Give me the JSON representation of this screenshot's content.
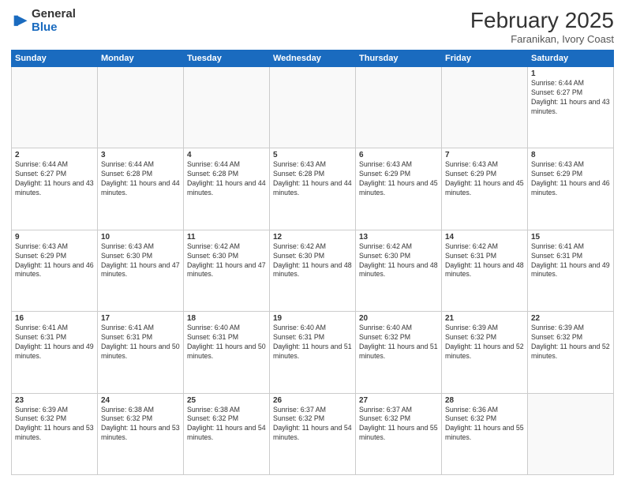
{
  "logo": {
    "general": "General",
    "blue": "Blue"
  },
  "title": "February 2025",
  "location": "Faranikan, Ivory Coast",
  "days_of_week": [
    "Sunday",
    "Monday",
    "Tuesday",
    "Wednesday",
    "Thursday",
    "Friday",
    "Saturday"
  ],
  "weeks": [
    [
      {
        "day": "",
        "info": ""
      },
      {
        "day": "",
        "info": ""
      },
      {
        "day": "",
        "info": ""
      },
      {
        "day": "",
        "info": ""
      },
      {
        "day": "",
        "info": ""
      },
      {
        "day": "",
        "info": ""
      },
      {
        "day": "1",
        "info": "Sunrise: 6:44 AM\nSunset: 6:27 PM\nDaylight: 11 hours and 43 minutes."
      }
    ],
    [
      {
        "day": "2",
        "info": "Sunrise: 6:44 AM\nSunset: 6:27 PM\nDaylight: 11 hours and 43 minutes."
      },
      {
        "day": "3",
        "info": "Sunrise: 6:44 AM\nSunset: 6:28 PM\nDaylight: 11 hours and 44 minutes."
      },
      {
        "day": "4",
        "info": "Sunrise: 6:44 AM\nSunset: 6:28 PM\nDaylight: 11 hours and 44 minutes."
      },
      {
        "day": "5",
        "info": "Sunrise: 6:43 AM\nSunset: 6:28 PM\nDaylight: 11 hours and 44 minutes."
      },
      {
        "day": "6",
        "info": "Sunrise: 6:43 AM\nSunset: 6:29 PM\nDaylight: 11 hours and 45 minutes."
      },
      {
        "day": "7",
        "info": "Sunrise: 6:43 AM\nSunset: 6:29 PM\nDaylight: 11 hours and 45 minutes."
      },
      {
        "day": "8",
        "info": "Sunrise: 6:43 AM\nSunset: 6:29 PM\nDaylight: 11 hours and 46 minutes."
      }
    ],
    [
      {
        "day": "9",
        "info": "Sunrise: 6:43 AM\nSunset: 6:29 PM\nDaylight: 11 hours and 46 minutes."
      },
      {
        "day": "10",
        "info": "Sunrise: 6:43 AM\nSunset: 6:30 PM\nDaylight: 11 hours and 47 minutes."
      },
      {
        "day": "11",
        "info": "Sunrise: 6:42 AM\nSunset: 6:30 PM\nDaylight: 11 hours and 47 minutes."
      },
      {
        "day": "12",
        "info": "Sunrise: 6:42 AM\nSunset: 6:30 PM\nDaylight: 11 hours and 48 minutes."
      },
      {
        "day": "13",
        "info": "Sunrise: 6:42 AM\nSunset: 6:30 PM\nDaylight: 11 hours and 48 minutes."
      },
      {
        "day": "14",
        "info": "Sunrise: 6:42 AM\nSunset: 6:31 PM\nDaylight: 11 hours and 48 minutes."
      },
      {
        "day": "15",
        "info": "Sunrise: 6:41 AM\nSunset: 6:31 PM\nDaylight: 11 hours and 49 minutes."
      }
    ],
    [
      {
        "day": "16",
        "info": "Sunrise: 6:41 AM\nSunset: 6:31 PM\nDaylight: 11 hours and 49 minutes."
      },
      {
        "day": "17",
        "info": "Sunrise: 6:41 AM\nSunset: 6:31 PM\nDaylight: 11 hours and 50 minutes."
      },
      {
        "day": "18",
        "info": "Sunrise: 6:40 AM\nSunset: 6:31 PM\nDaylight: 11 hours and 50 minutes."
      },
      {
        "day": "19",
        "info": "Sunrise: 6:40 AM\nSunset: 6:31 PM\nDaylight: 11 hours and 51 minutes."
      },
      {
        "day": "20",
        "info": "Sunrise: 6:40 AM\nSunset: 6:32 PM\nDaylight: 11 hours and 51 minutes."
      },
      {
        "day": "21",
        "info": "Sunrise: 6:39 AM\nSunset: 6:32 PM\nDaylight: 11 hours and 52 minutes."
      },
      {
        "day": "22",
        "info": "Sunrise: 6:39 AM\nSunset: 6:32 PM\nDaylight: 11 hours and 52 minutes."
      }
    ],
    [
      {
        "day": "23",
        "info": "Sunrise: 6:39 AM\nSunset: 6:32 PM\nDaylight: 11 hours and 53 minutes."
      },
      {
        "day": "24",
        "info": "Sunrise: 6:38 AM\nSunset: 6:32 PM\nDaylight: 11 hours and 53 minutes."
      },
      {
        "day": "25",
        "info": "Sunrise: 6:38 AM\nSunset: 6:32 PM\nDaylight: 11 hours and 54 minutes."
      },
      {
        "day": "26",
        "info": "Sunrise: 6:37 AM\nSunset: 6:32 PM\nDaylight: 11 hours and 54 minutes."
      },
      {
        "day": "27",
        "info": "Sunrise: 6:37 AM\nSunset: 6:32 PM\nDaylight: 11 hours and 55 minutes."
      },
      {
        "day": "28",
        "info": "Sunrise: 6:36 AM\nSunset: 6:32 PM\nDaylight: 11 hours and 55 minutes."
      },
      {
        "day": "",
        "info": ""
      }
    ]
  ]
}
